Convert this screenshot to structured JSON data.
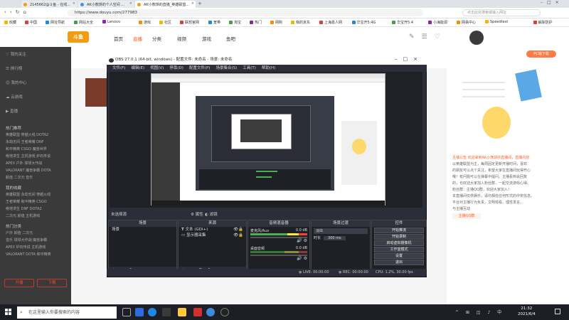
{
  "browser": {
    "tabs": [
      {
        "label": "2145662@斗鱼 - 在线...",
        "color": "#f39c12"
      },
      {
        "label": "AK小熊饼的个人空间 ...",
        "color": "#4a90e2"
      },
      {
        "label": "AK小熊饼的直播_英雄联盟...",
        "color": "#f39c12"
      }
    ],
    "url": "https://www.douyu.com/277983",
    "search_placeholder": "点击此处搜索或输入网址",
    "bookmarks": [
      "收藏",
      "中国",
      "网址导航",
      "网站大全",
      "Lenovo",
      "游戏",
      "社区",
      "联想官网",
      "宽带",
      "淘宝",
      "热门",
      "网购",
      "我的京东",
      "上海嘉人网",
      "华宝开5:4G",
      "华宝开5:4",
      "小海能源",
      "网易中心",
      "Speedtest",
      "解除防护",
      "QQ游戏",
      "更多"
    ]
  },
  "douyu": {
    "logo": "斗鱼",
    "nav": [
      "首页",
      "直播",
      "分类",
      "视频",
      "游戏",
      "鱼吧"
    ],
    "active_nav": "直播",
    "sidebar": {
      "items": [
        "我的关注",
        "排行榜",
        "我的中心",
        "云游戏",
        "直播"
      ],
      "sections": [
        {
          "title": "热门推荐",
          "rows": [
            "英雄联盟  穿越火线  DOTA2",
            "永劫无间  王者荣耀  DNF",
            "和平精英  CSGO  魔兽世界",
            "绝地求生  主机游戏  炉石传说",
            "APEX  户外  球球大作战",
            "VALORANT  魔兽争霸  DOTA",
            "颜值  二次元  音乐"
          ]
        },
        {
          "title": "我的收藏",
          "rows": [
            "英雄联盟  永劫无间  穿越火线",
            "王者荣耀  和平精英  CSGO",
            "绝地求生  DNF  DOTA2",
            "二次元  颜值  主机游戏"
          ]
        },
        {
          "title": "热门分类",
          "rows": [
            "户外  颜值  二次元",
            "音乐  球球大作战  魔兽争霸",
            "APEX  炉石传说  主机游戏",
            "VALORANT  DOTA  和平精英"
          ]
        }
      ],
      "footer_buttons": [
        "开播",
        "下载"
      ]
    },
    "right_panel": {
      "button": "PC端下载",
      "text_lines": [
        "主播公告  欢迎来到AK小熊饼的直播间，直播内容",
        "以英雄联盟为主，每周固定更新开播时间，喜欢",
        "的朋友可以点个关注，希望大家在直播间玩得开心",
        "哦！有问题可以在弹幕中提问，主播看到会回复",
        "的，也欢迎大家加入粉丝群，一起交流游戏心得。",
        "粉丝群：主播QQ群，欢迎大家加入！",
        "本直播间仅供娱乐，请勿相信任何形式的中奖信息。",
        "平台对主播行为负责，文明观看，理性发言。",
        "与主播互动"
      ],
      "qq_link": "主播QQ群"
    }
  },
  "obs": {
    "title": "OBS 27.0.1 (64-bit, windows) - 配置文件: 未命名 - 场景: 未命名",
    "menu": [
      "文件(F)",
      "编辑(E)",
      "视图(V)",
      "停靠(D)",
      "配置文件(P)",
      "场景集合(S)",
      "工具(T)",
      "帮助(H)"
    ],
    "source_bar": {
      "label": "未选择源",
      "props": "属性",
      "filters": "滤镜"
    },
    "docks": {
      "scenes": {
        "title": "场景",
        "items": [
          "场景"
        ]
      },
      "sources": {
        "title": "来源",
        "items": [
          "文本 (GDI+)",
          "显示器采集"
        ]
      },
      "mixer": {
        "title": "音频混音器",
        "channels": [
          {
            "name": "麦克风/Aux",
            "db": "0.0 dB"
          },
          {
            "name": "桌面音频",
            "db": "0.0 dB"
          }
        ]
      },
      "transitions": {
        "title": "场景过渡",
        "type": "淡出",
        "duration_label": "时长",
        "duration": "300 ms"
      },
      "controls": {
        "title": "控件",
        "buttons": [
          "开始推流",
          "开始录制",
          "启动虚拟摄像机",
          "工作室模式",
          "设置",
          "退出"
        ]
      }
    },
    "status": {
      "live": "LIVE: 00:00:00",
      "rec": "REC: 00:00:00",
      "cpu": "CPU: 1.2%, 30.00 fps"
    }
  },
  "taskbar": {
    "search_placeholder": "在这里输入你要搜索的内容",
    "time": "21:32",
    "date": "2021/6/4"
  },
  "colors": {
    "accent": "#ff5d23",
    "obs_bg": "#2b2e38",
    "taskbar": "#1c1f26"
  }
}
